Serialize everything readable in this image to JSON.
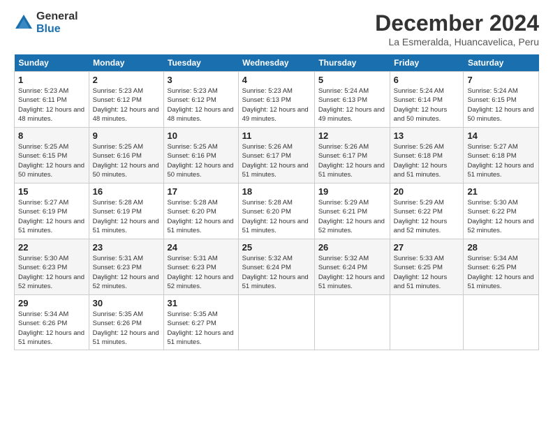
{
  "header": {
    "logo": {
      "general": "General",
      "blue": "Blue"
    },
    "title": "December 2024",
    "subtitle": "La Esmeralda, Huancavelica, Peru"
  },
  "calendar": {
    "headers": [
      "Sunday",
      "Monday",
      "Tuesday",
      "Wednesday",
      "Thursday",
      "Friday",
      "Saturday"
    ],
    "weeks": [
      [
        {
          "day": "",
          "info": ""
        },
        {
          "day": "2",
          "info": "Sunrise: 5:23 AM\nSunset: 6:12 PM\nDaylight: 12 hours\nand 48 minutes."
        },
        {
          "day": "3",
          "info": "Sunrise: 5:23 AM\nSunset: 6:12 PM\nDaylight: 12 hours\nand 48 minutes."
        },
        {
          "day": "4",
          "info": "Sunrise: 5:23 AM\nSunset: 6:13 PM\nDaylight: 12 hours\nand 49 minutes."
        },
        {
          "day": "5",
          "info": "Sunrise: 5:24 AM\nSunset: 6:13 PM\nDaylight: 12 hours\nand 49 minutes."
        },
        {
          "day": "6",
          "info": "Sunrise: 5:24 AM\nSunset: 6:14 PM\nDaylight: 12 hours\nand 50 minutes."
        },
        {
          "day": "7",
          "info": "Sunrise: 5:24 AM\nSunset: 6:15 PM\nDaylight: 12 hours\nand 50 minutes."
        }
      ],
      [
        {
          "day": "8",
          "info": "Sunrise: 5:25 AM\nSunset: 6:15 PM\nDaylight: 12 hours\nand 50 minutes."
        },
        {
          "day": "9",
          "info": "Sunrise: 5:25 AM\nSunset: 6:16 PM\nDaylight: 12 hours\nand 50 minutes."
        },
        {
          "day": "10",
          "info": "Sunrise: 5:25 AM\nSunset: 6:16 PM\nDaylight: 12 hours\nand 50 minutes."
        },
        {
          "day": "11",
          "info": "Sunrise: 5:26 AM\nSunset: 6:17 PM\nDaylight: 12 hours\nand 51 minutes."
        },
        {
          "day": "12",
          "info": "Sunrise: 5:26 AM\nSunset: 6:17 PM\nDaylight: 12 hours\nand 51 minutes."
        },
        {
          "day": "13",
          "info": "Sunrise: 5:26 AM\nSunset: 6:18 PM\nDaylight: 12 hours\nand 51 minutes."
        },
        {
          "day": "14",
          "info": "Sunrise: 5:27 AM\nSunset: 6:18 PM\nDaylight: 12 hours\nand 51 minutes."
        }
      ],
      [
        {
          "day": "15",
          "info": "Sunrise: 5:27 AM\nSunset: 6:19 PM\nDaylight: 12 hours\nand 51 minutes."
        },
        {
          "day": "16",
          "info": "Sunrise: 5:28 AM\nSunset: 6:19 PM\nDaylight: 12 hours\nand 51 minutes."
        },
        {
          "day": "17",
          "info": "Sunrise: 5:28 AM\nSunset: 6:20 PM\nDaylight: 12 hours\nand 51 minutes."
        },
        {
          "day": "18",
          "info": "Sunrise: 5:28 AM\nSunset: 6:20 PM\nDaylight: 12 hours\nand 51 minutes."
        },
        {
          "day": "19",
          "info": "Sunrise: 5:29 AM\nSunset: 6:21 PM\nDaylight: 12 hours\nand 52 minutes."
        },
        {
          "day": "20",
          "info": "Sunrise: 5:29 AM\nSunset: 6:22 PM\nDaylight: 12 hours\nand 52 minutes."
        },
        {
          "day": "21",
          "info": "Sunrise: 5:30 AM\nSunset: 6:22 PM\nDaylight: 12 hours\nand 52 minutes."
        }
      ],
      [
        {
          "day": "22",
          "info": "Sunrise: 5:30 AM\nSunset: 6:23 PM\nDaylight: 12 hours\nand 52 minutes."
        },
        {
          "day": "23",
          "info": "Sunrise: 5:31 AM\nSunset: 6:23 PM\nDaylight: 12 hours\nand 52 minutes."
        },
        {
          "day": "24",
          "info": "Sunrise: 5:31 AM\nSunset: 6:23 PM\nDaylight: 12 hours\nand 52 minutes."
        },
        {
          "day": "25",
          "info": "Sunrise: 5:32 AM\nSunset: 6:24 PM\nDaylight: 12 hours\nand 51 minutes."
        },
        {
          "day": "26",
          "info": "Sunrise: 5:32 AM\nSunset: 6:24 PM\nDaylight: 12 hours\nand 51 minutes."
        },
        {
          "day": "27",
          "info": "Sunrise: 5:33 AM\nSunset: 6:25 PM\nDaylight: 12 hours\nand 51 minutes."
        },
        {
          "day": "28",
          "info": "Sunrise: 5:34 AM\nSunset: 6:25 PM\nDaylight: 12 hours\nand 51 minutes."
        }
      ],
      [
        {
          "day": "29",
          "info": "Sunrise: 5:34 AM\nSunset: 6:26 PM\nDaylight: 12 hours\nand 51 minutes."
        },
        {
          "day": "30",
          "info": "Sunrise: 5:35 AM\nSunset: 6:26 PM\nDaylight: 12 hours\nand 51 minutes."
        },
        {
          "day": "31",
          "info": "Sunrise: 5:35 AM\nSunset: 6:27 PM\nDaylight: 12 hours\nand 51 minutes."
        },
        {
          "day": "",
          "info": ""
        },
        {
          "day": "",
          "info": ""
        },
        {
          "day": "",
          "info": ""
        },
        {
          "day": "",
          "info": ""
        }
      ]
    ],
    "week1_day1": {
      "day": "1",
      "info": "Sunrise: 5:23 AM\nSunset: 6:11 PM\nDaylight: 12 hours\nand 48 minutes."
    }
  }
}
